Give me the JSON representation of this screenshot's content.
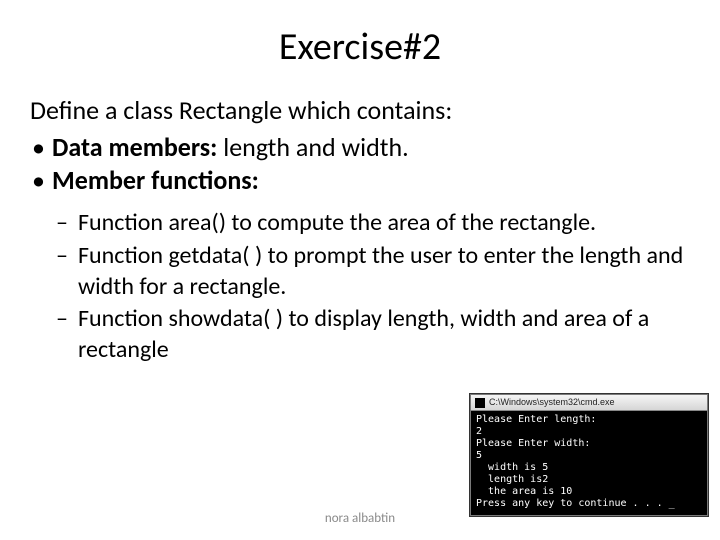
{
  "title": "Exercise#2",
  "intro": "Define a class Rectangle which contains:",
  "bullets": [
    {
      "label": "Data members:",
      "text": " length and width."
    },
    {
      "label": "Member functions:",
      "text": ""
    }
  ],
  "sub_bullets": [
    "Function area() to compute the area of the rectangle.",
    "Function getdata( ) to prompt the user to enter the length and width for a rectangle.",
    "Function showdata( ) to display length, width and area of a rectangle"
  ],
  "console": {
    "title": "C:\\Windows\\system32\\cmd.exe",
    "output": "Please Enter length:\n2\nPlease Enter width:\n5\n  width is 5\n  length is2\n  the area is 10\nPress any key to continue . . . _"
  },
  "footer": "nora albabtin"
}
